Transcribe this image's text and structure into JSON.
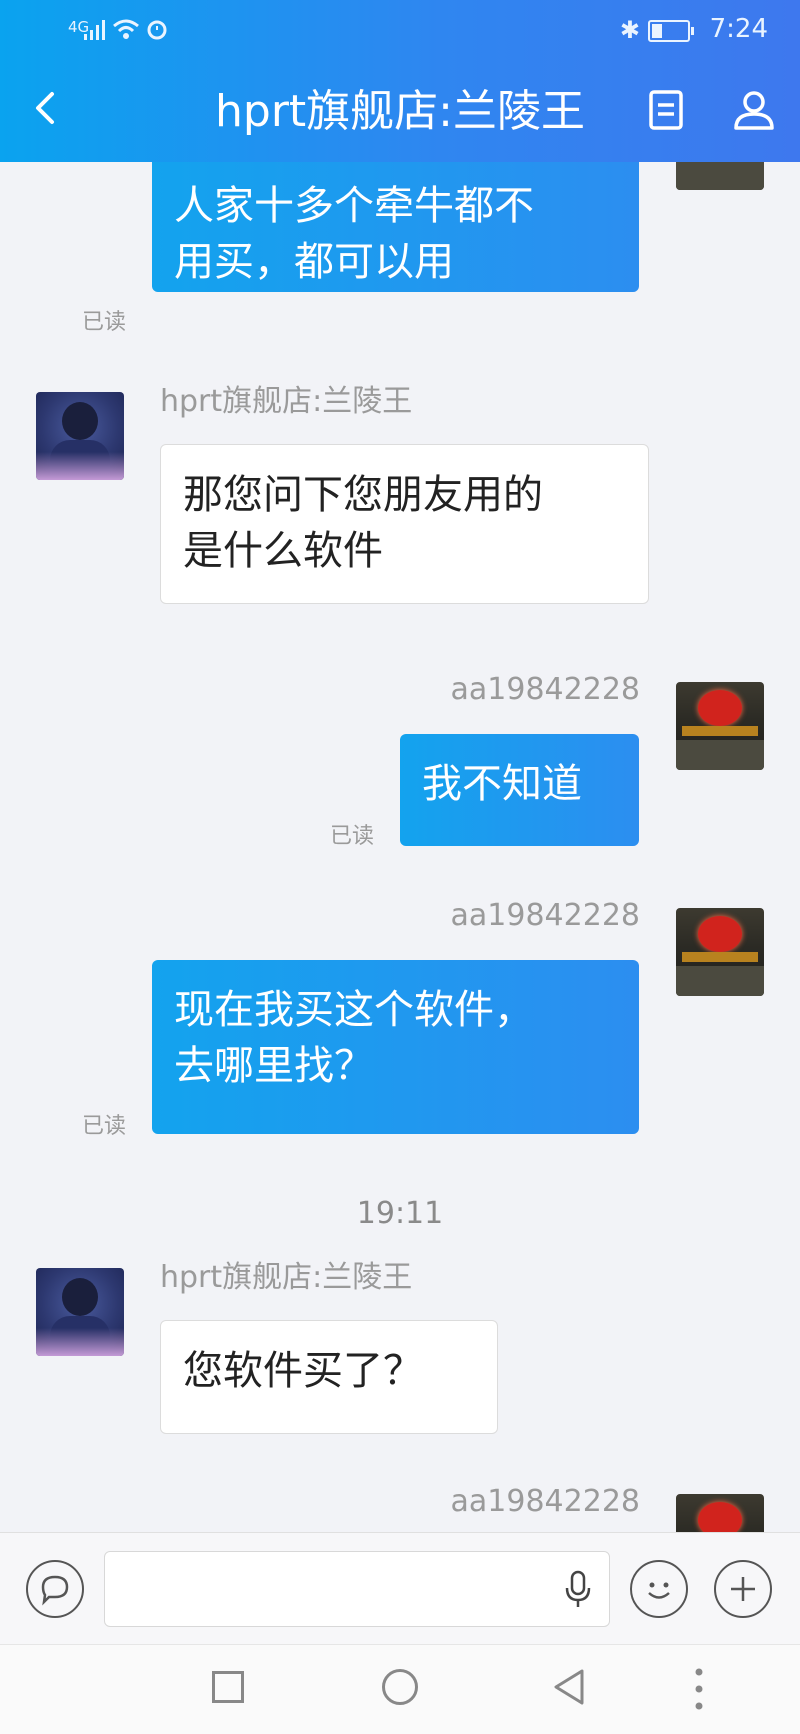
{
  "status_bar": {
    "network": "4G",
    "time": "7:24"
  },
  "header": {
    "title": "hprt旗舰店:兰陵王",
    "back_icon": "chevron-left-icon",
    "notes_icon": "document-icon",
    "profile_icon": "person-icon"
  },
  "messages": [
    {
      "side": "out",
      "text_line1": "人家十多个牵牛都不",
      "text_line2": "用买，都可以用",
      "status": "已读"
    },
    {
      "side": "in",
      "sender": "hprt旗舰店:兰陵王",
      "text_line1": "那您问下您朋友用的",
      "text_line2": "是什么软件"
    },
    {
      "side": "out",
      "sender": "aa19842228",
      "text": "我不知道",
      "status": "已读"
    },
    {
      "side": "out",
      "sender": "aa19842228",
      "text_line1": "现在我买这个软件，",
      "text_line2": "去哪里找？",
      "status": "已读"
    },
    {
      "side": "in",
      "sender": "hprt旗舰店:兰陵王",
      "text": "您软件买了？"
    },
    {
      "side": "out",
      "sender": "aa19842228"
    }
  ],
  "time_separator": "19:11",
  "input_bar": {
    "placeholder": "",
    "voice_icon": "microphone-icon",
    "emoji_icon": "smiley-icon",
    "plus_icon": "plus-icon",
    "chat_icon": "speech-bubble-icon"
  },
  "nav_bar": {
    "recent_icon": "square-icon",
    "home_icon": "circle-icon",
    "back_icon": "triangle-back-icon",
    "menu_icon": "dots-icon"
  }
}
